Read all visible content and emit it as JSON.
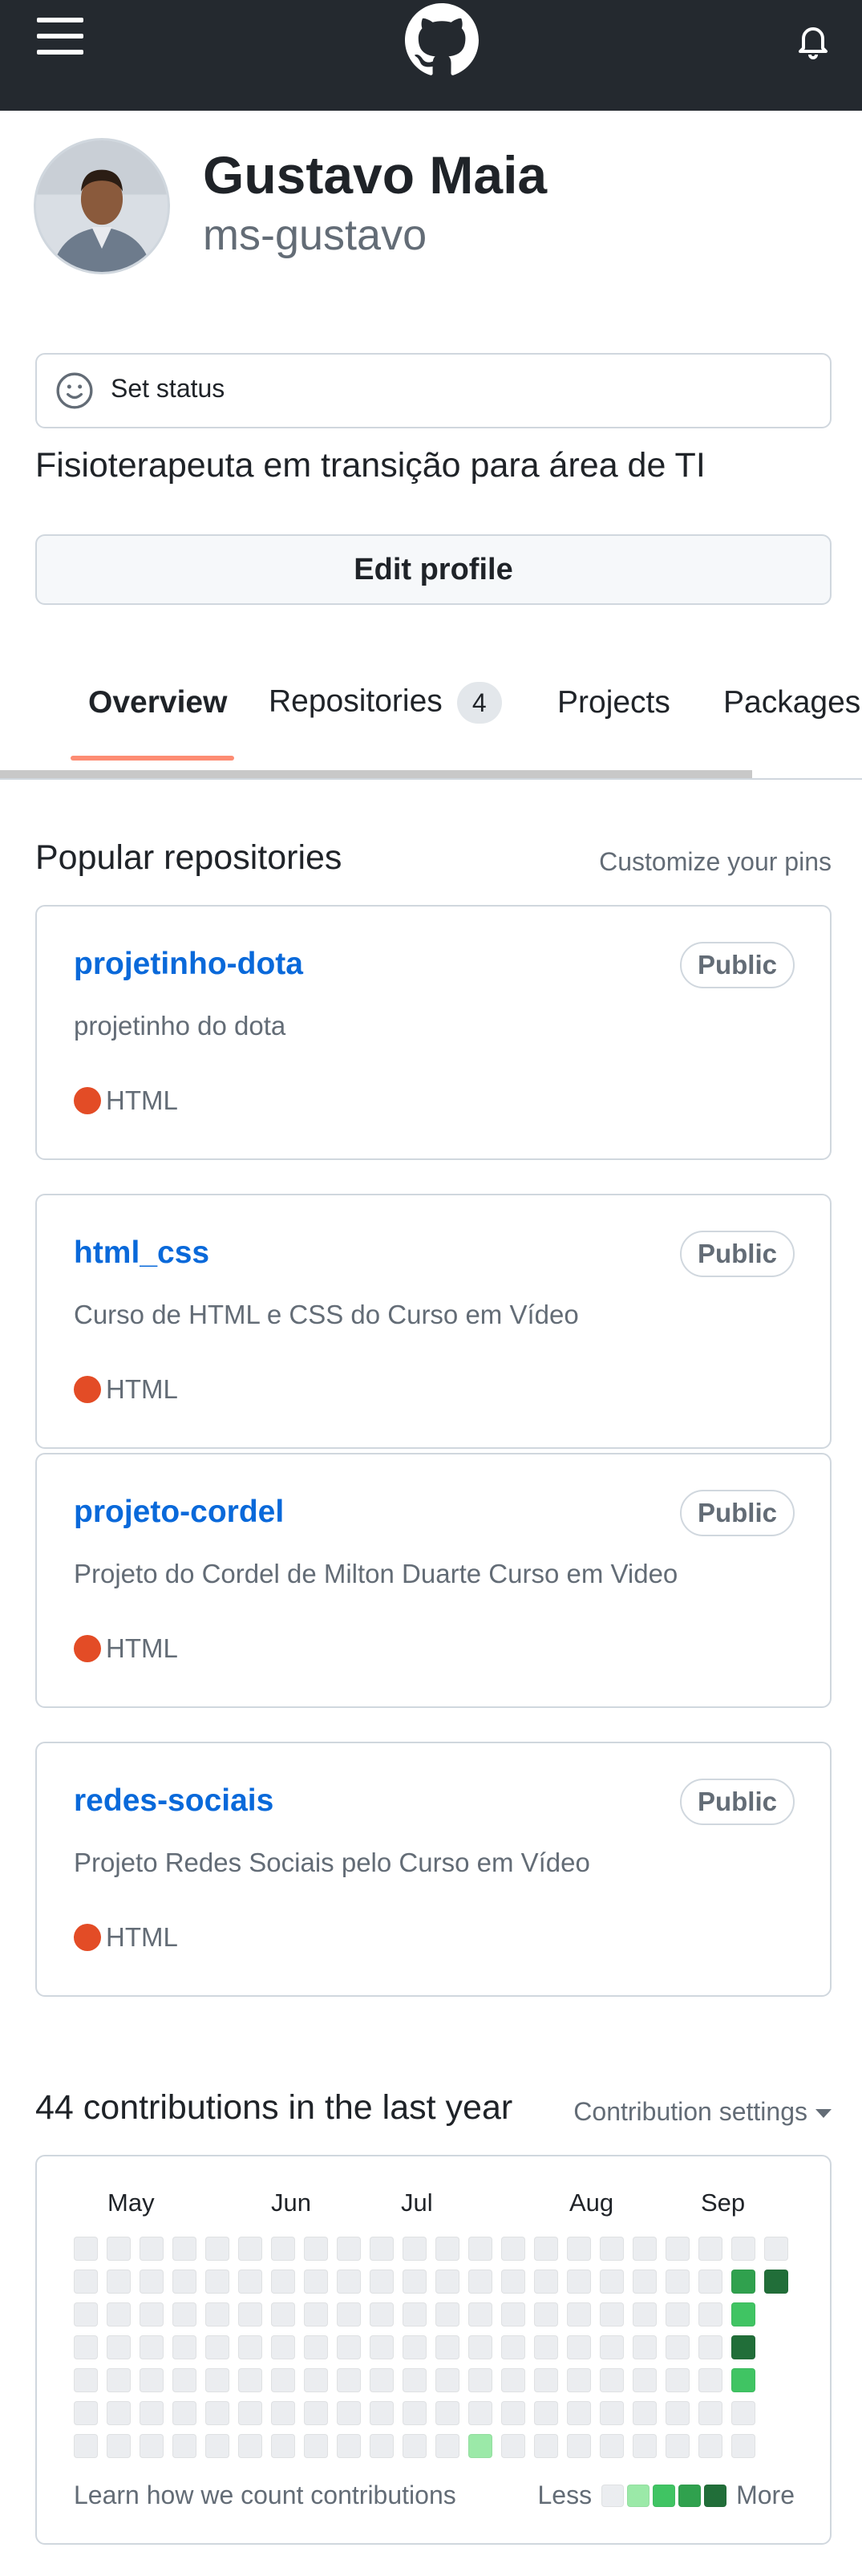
{
  "header": {
    "menu_icon": "hamburger-icon",
    "logo_icon": "github-mark-icon",
    "notifications_icon": "bell-icon"
  },
  "profile": {
    "avatar_alt": "avatar",
    "name": "Gustavo Maia",
    "login": "ms-gustavo",
    "status_label": "Set status",
    "status_icon": "smiley-icon",
    "bio": "Fisioterapeuta em transição para área de TI",
    "edit_button": "Edit profile"
  },
  "tabs": [
    {
      "label": "Overview",
      "active": true
    },
    {
      "label": "Repositories",
      "count": "4"
    },
    {
      "label": "Projects"
    },
    {
      "label": "Packages"
    }
  ],
  "popular": {
    "title": "Popular repositories",
    "customize": "Customize your pins",
    "repos": [
      {
        "name": "projetinho-dota",
        "visibility": "Public",
        "description": "projetinho do dota",
        "language": "HTML"
      },
      {
        "name": "html_css",
        "visibility": "Public",
        "description": "Curso de HTML e CSS do Curso em Vídeo",
        "language": "HTML"
      },
      {
        "name": "projeto-cordel",
        "visibility": "Public",
        "description": "Projeto do Cordel de Milton Duarte Curso em Video",
        "language": "HTML"
      },
      {
        "name": "redes-sociais",
        "visibility": "Public",
        "description": "Projeto Redes Sociais pelo Curso em Vídeo",
        "language": "HTML"
      }
    ],
    "language_color": "#e34c26"
  },
  "contributions": {
    "title": "44 contributions in the last year",
    "settings": "Contribution settings",
    "months": [
      "May",
      "Jun",
      "Jul",
      "Aug",
      "Sep"
    ],
    "learn_link": "Learn how we count contributions",
    "legend_less": "Less",
    "legend_more": "More",
    "level_colors": [
      "#ebedf0",
      "#9be9a8",
      "#40c463",
      "#30a14e",
      "#216e39"
    ],
    "weeks": 22,
    "active_cells": [
      {
        "week": 20,
        "day": 1,
        "level": 3
      },
      {
        "week": 21,
        "day": 1,
        "level": 4
      },
      {
        "week": 20,
        "day": 2,
        "level": 2
      },
      {
        "week": 20,
        "day": 3,
        "level": 4
      },
      {
        "week": 20,
        "day": 4,
        "level": 2
      },
      {
        "week": 12,
        "day": 6,
        "level": 1
      }
    ]
  }
}
